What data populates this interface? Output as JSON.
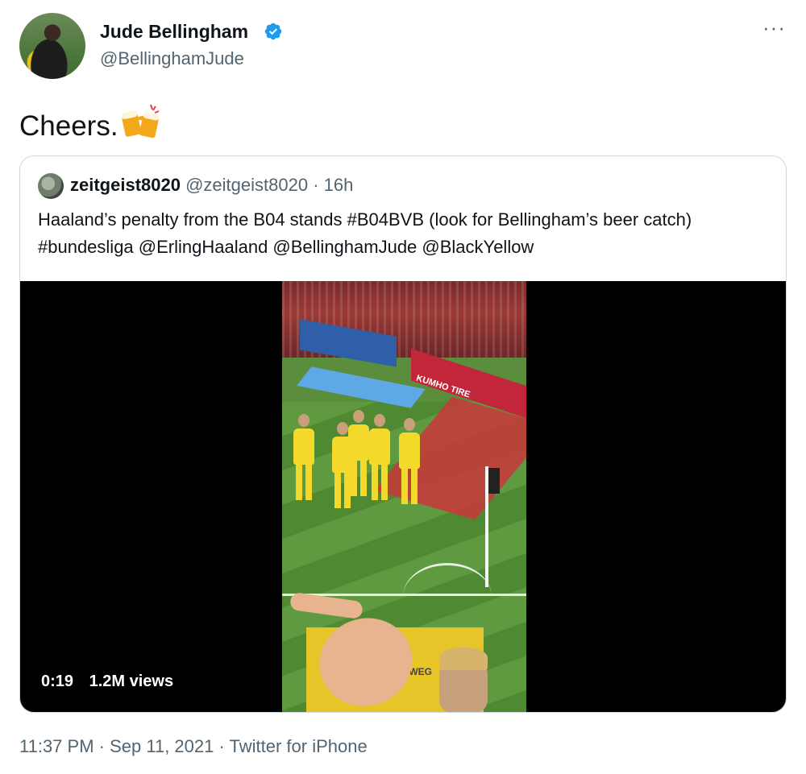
{
  "author": {
    "name": "Jude Bellingham",
    "handle": "@BellinghamJude",
    "verified_icon": "verified-badge-icon",
    "more_label": "···"
  },
  "tweet": {
    "text": "Cheers.",
    "emoji": "beer-mugs-clinking"
  },
  "quoted": {
    "name": "zeitgeist8020",
    "handle": "@zeitgeist8020",
    "separator": "·",
    "time": "16h",
    "text": "Haaland’s penalty from the B04 stands #B04BVB (look for Bellingham’s beer catch) #bundesliga @ErlingHaaland @BellinghamJude @BlackYellow",
    "video": {
      "duration": "0:19",
      "views": "1.2M views",
      "ad_text": "KUMHO TIRE",
      "board_text": "TWEG"
    }
  },
  "footer": {
    "time": "11:37 PM",
    "sep1": " · ",
    "date": "Sep 11, 2021",
    "sep2": " · ",
    "source": "Twitter for iPhone"
  },
  "colors": {
    "text": "#0f1419",
    "secondary": "#536471",
    "verified": "#1d9bf0",
    "border": "#cfd9de"
  }
}
